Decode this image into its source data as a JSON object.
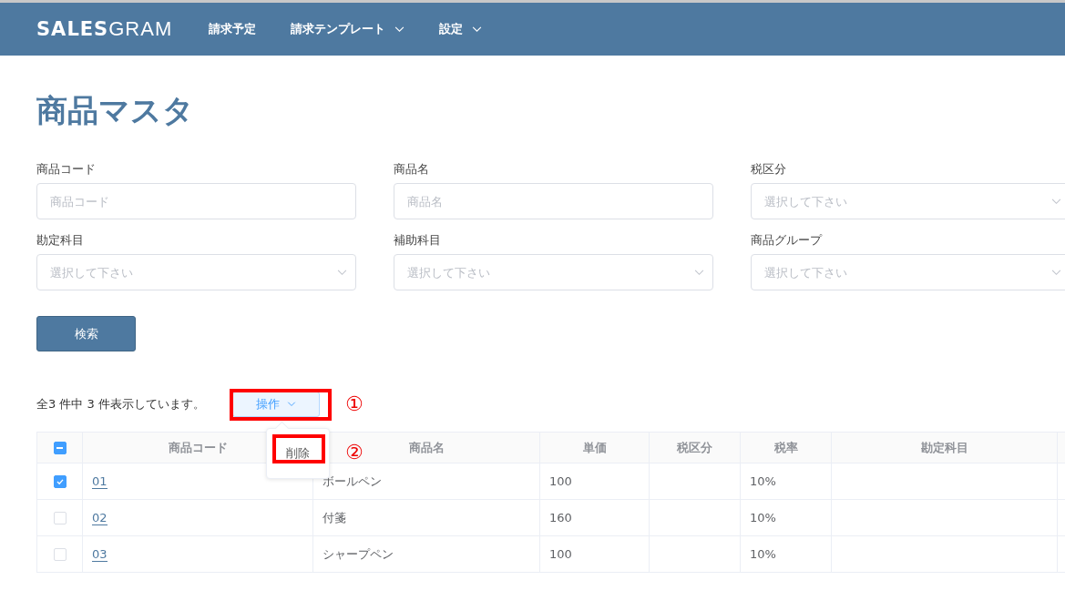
{
  "header": {
    "logo_bold": "SALES",
    "logo_light": "GRAM",
    "nav": [
      {
        "label": "請求予定",
        "has_menu": false
      },
      {
        "label": "請求テンプレート",
        "has_menu": true
      },
      {
        "label": "設定",
        "has_menu": true
      }
    ]
  },
  "page_title": "商品マスタ",
  "filters": [
    {
      "label": "商品コード",
      "kind": "text",
      "placeholder": "商品コード"
    },
    {
      "label": "商品名",
      "kind": "text",
      "placeholder": "商品名"
    },
    {
      "label": "税区分",
      "kind": "select",
      "placeholder": "選択して下さい"
    },
    {
      "label": "勘定科目",
      "kind": "select",
      "placeholder": "選択して下さい"
    },
    {
      "label": "補助科目",
      "kind": "select",
      "placeholder": "選択して下さい"
    },
    {
      "label": "商品グループ",
      "kind": "select",
      "placeholder": "選択して下さい"
    }
  ],
  "search_button": "検索",
  "result_count": "全3 件中 3 件表示しています。",
  "actions_button": {
    "label": "操作",
    "expanded": true,
    "menu": [
      "削除"
    ]
  },
  "callouts": [
    "①",
    "②"
  ],
  "table": {
    "header_checkbox": {
      "indeterminate": true
    },
    "columns": [
      "商品コード",
      "商品名",
      "単価",
      "税区分",
      "税率",
      "勘定科目"
    ],
    "rows": [
      {
        "selected": true,
        "cells": [
          "01",
          "ボールペン",
          "100",
          "",
          "10%",
          ""
        ]
      },
      {
        "selected": false,
        "cells": [
          "02",
          "付箋",
          "160",
          "",
          "10%",
          ""
        ]
      },
      {
        "selected": false,
        "cells": [
          "03",
          "シャープペン",
          "100",
          "",
          "10%",
          ""
        ]
      }
    ]
  }
}
